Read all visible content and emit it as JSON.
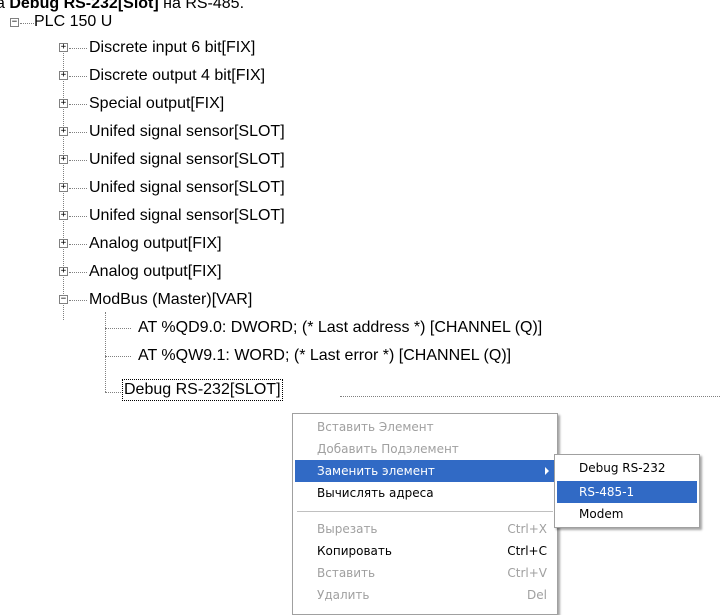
{
  "caption": {
    "prefix": "а ",
    "bold": "Debug RS-232[Slot]",
    "suffix": " на RS-485."
  },
  "tree": {
    "root": {
      "label": "PLC 150 U",
      "expander": "⊟"
    },
    "children": [
      {
        "label": "Discrete input 6 bit[FIX]",
        "expander": "+"
      },
      {
        "label": "Discrete output 4 bit[FIX]",
        "expander": "+"
      },
      {
        "label": "Special output[FIX]",
        "expander": "+"
      },
      {
        "label": "Unifed signal sensor[SLOT]",
        "expander": "+"
      },
      {
        "label": "Unifed signal sensor[SLOT]",
        "expander": "+"
      },
      {
        "label": "Unifed signal sensor[SLOT]",
        "expander": "+"
      },
      {
        "label": "Unifed signal sensor[SLOT]",
        "expander": "+"
      },
      {
        "label": "Analog output[FIX]",
        "expander": "+"
      },
      {
        "label": "Analog output[FIX]",
        "expander": "+"
      },
      {
        "label": "ModBus (Master)[VAR]",
        "expander": "−"
      }
    ],
    "modbus_children": [
      {
        "label": "AT %QD9.0: DWORD; (* Last address *) [CHANNEL (Q)]"
      },
      {
        "label": "AT %QW9.1: WORD; (* Last error *) [CHANNEL (Q)]"
      },
      {
        "label": "Debug RS-232[SLOT]"
      }
    ]
  },
  "context_menu": {
    "items": [
      {
        "label": "Вставить Элемент",
        "state": "disabled"
      },
      {
        "label": "Добавить Подэлемент",
        "state": "disabled"
      },
      {
        "label": "Заменить элемент",
        "state": "highlight",
        "submenu": true
      },
      {
        "label": "Вычислять адреса",
        "state": "enabled"
      },
      {
        "label": "Вырезать",
        "shortcut": "Ctrl+X",
        "state": "disabled"
      },
      {
        "label": "Копировать",
        "shortcut": "Ctrl+C",
        "state": "enabled"
      },
      {
        "label": "Вставить",
        "shortcut": "Ctrl+V",
        "state": "disabled"
      },
      {
        "label": "Удалить",
        "shortcut": "Del",
        "state": "disabled"
      }
    ]
  },
  "submenu": {
    "items": [
      {
        "label": "Debug RS-232",
        "state": "enabled"
      },
      {
        "label": "RS-485-1",
        "state": "highlight"
      },
      {
        "label": "Modem",
        "state": "enabled"
      }
    ]
  },
  "colors": {
    "highlight": "#316ac5",
    "disabled_text": "#a0a0a0",
    "tree_lines": "#808080"
  }
}
